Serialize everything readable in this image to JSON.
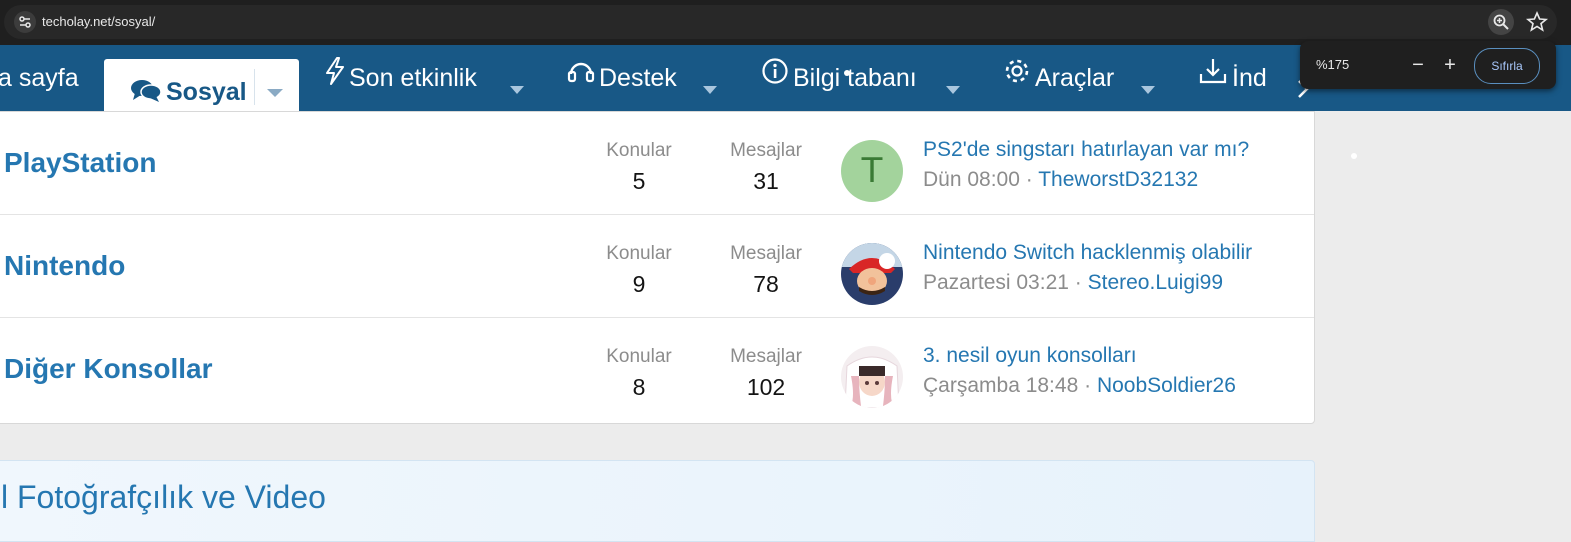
{
  "browser": {
    "url": "techolay.net/sosyal/",
    "zoom_percent": "%175",
    "zoom_minus": "−",
    "zoom_plus": "+",
    "zoom_reset": "Sıfırla"
  },
  "nav": {
    "items": [
      {
        "label": "a sayfa"
      },
      {
        "label": "Sosyal",
        "icon": "comments-icon",
        "active": true
      },
      {
        "label": "Son etkinlik",
        "icon": "bolt-icon"
      },
      {
        "label": "Destek",
        "icon": "headset-icon"
      },
      {
        "label": "Bilgi tabanı",
        "icon": "info-icon"
      },
      {
        "label": "Araçlar",
        "icon": "gear-icon"
      },
      {
        "label": "İnd",
        "icon": "download-icon"
      }
    ]
  },
  "forums": [
    {
      "title": "PlayStation",
      "topics_label": "Konular",
      "topics": "5",
      "messages_label": "Mesajlar",
      "messages": "31",
      "avatar_letter": "T",
      "avatar_color": "#a3d39c",
      "latest_title": "PS2'de singstarı hatırlayan var mı?",
      "latest_time": "Dün 08:00",
      "latest_user": "TheworstD32132"
    },
    {
      "title": "Nintendo",
      "topics_label": "Konular",
      "topics": "9",
      "messages_label": "Mesajlar",
      "messages": "78",
      "latest_title": "Nintendo Switch hacklenmiş olabilir",
      "latest_time": "Pazartesi 03:21",
      "latest_user": "Stereo.Luigi99"
    },
    {
      "title": "Diğer Konsollar",
      "topics_label": "Konular",
      "topics": "8",
      "messages_label": "Mesajlar",
      "messages": "102",
      "latest_title": "3. nesil oyun konsolları",
      "latest_time": "Çarşamba 18:48",
      "latest_user": "NoobSoldier26"
    }
  ],
  "next_category": {
    "label": "l Fotoğrafçılık ve Video"
  },
  "meta_separator": " · ",
  "colors": {
    "nav": "#185886",
    "link": "#2577b1",
    "accent": "#a8c7fa"
  }
}
